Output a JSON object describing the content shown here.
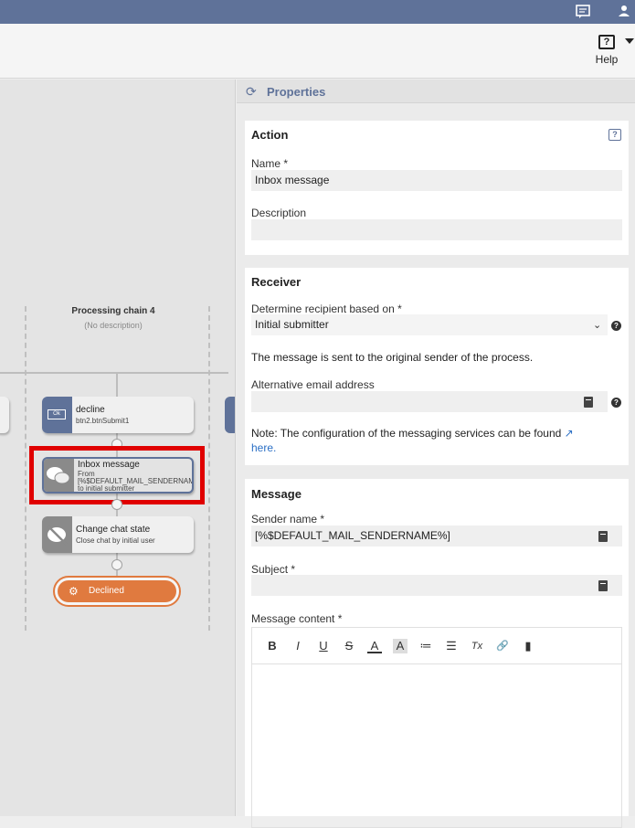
{
  "toolbar": {
    "help_label": "Help"
  },
  "canvas": {
    "chain_title": "Processing chain 4",
    "chain_desc": "(No description)",
    "nodes": [
      {
        "title": "decline",
        "subtitle": "btn2.btnSubmit1",
        "icon_label": "Ok"
      },
      {
        "title": "Inbox message",
        "subtitle": "From [%$DEFAULT_MAIL_SENDERNAME%] to initial submitter"
      },
      {
        "title": "Change chat state",
        "subtitle": "Close chat by initial user"
      }
    ],
    "end_label": "Declined"
  },
  "panel": {
    "title": "Properties",
    "action": {
      "title": "Action",
      "name_label": "Name *",
      "name_value": "Inbox message",
      "description_label": "Description",
      "description_value": ""
    },
    "receiver": {
      "title": "Receiver",
      "recipient_label": "Determine recipient based on *",
      "recipient_value": "Initial submitter",
      "recipient_note": "The message is sent to the original sender of the process.",
      "alt_email_label": "Alternative email address",
      "alt_email_value": "",
      "note_text": "Note: The configuration of the messaging services can be found",
      "note_link": "here."
    },
    "message": {
      "title": "Message",
      "sender_label": "Sender name *",
      "sender_value": "[%$DEFAULT_MAIL_SENDERNAME%]",
      "subject_label": "Subject *",
      "subject_value": "",
      "content_label": "Message content *",
      "toolbar": [
        "B",
        "I",
        "U",
        "S",
        "A",
        "A",
        "≔",
        "☰",
        "Tx",
        "🔗",
        "▮"
      ]
    }
  },
  "colors": {
    "accent": "#5f7299",
    "highlight": "#e00000",
    "end_state": "#e07a3f"
  }
}
